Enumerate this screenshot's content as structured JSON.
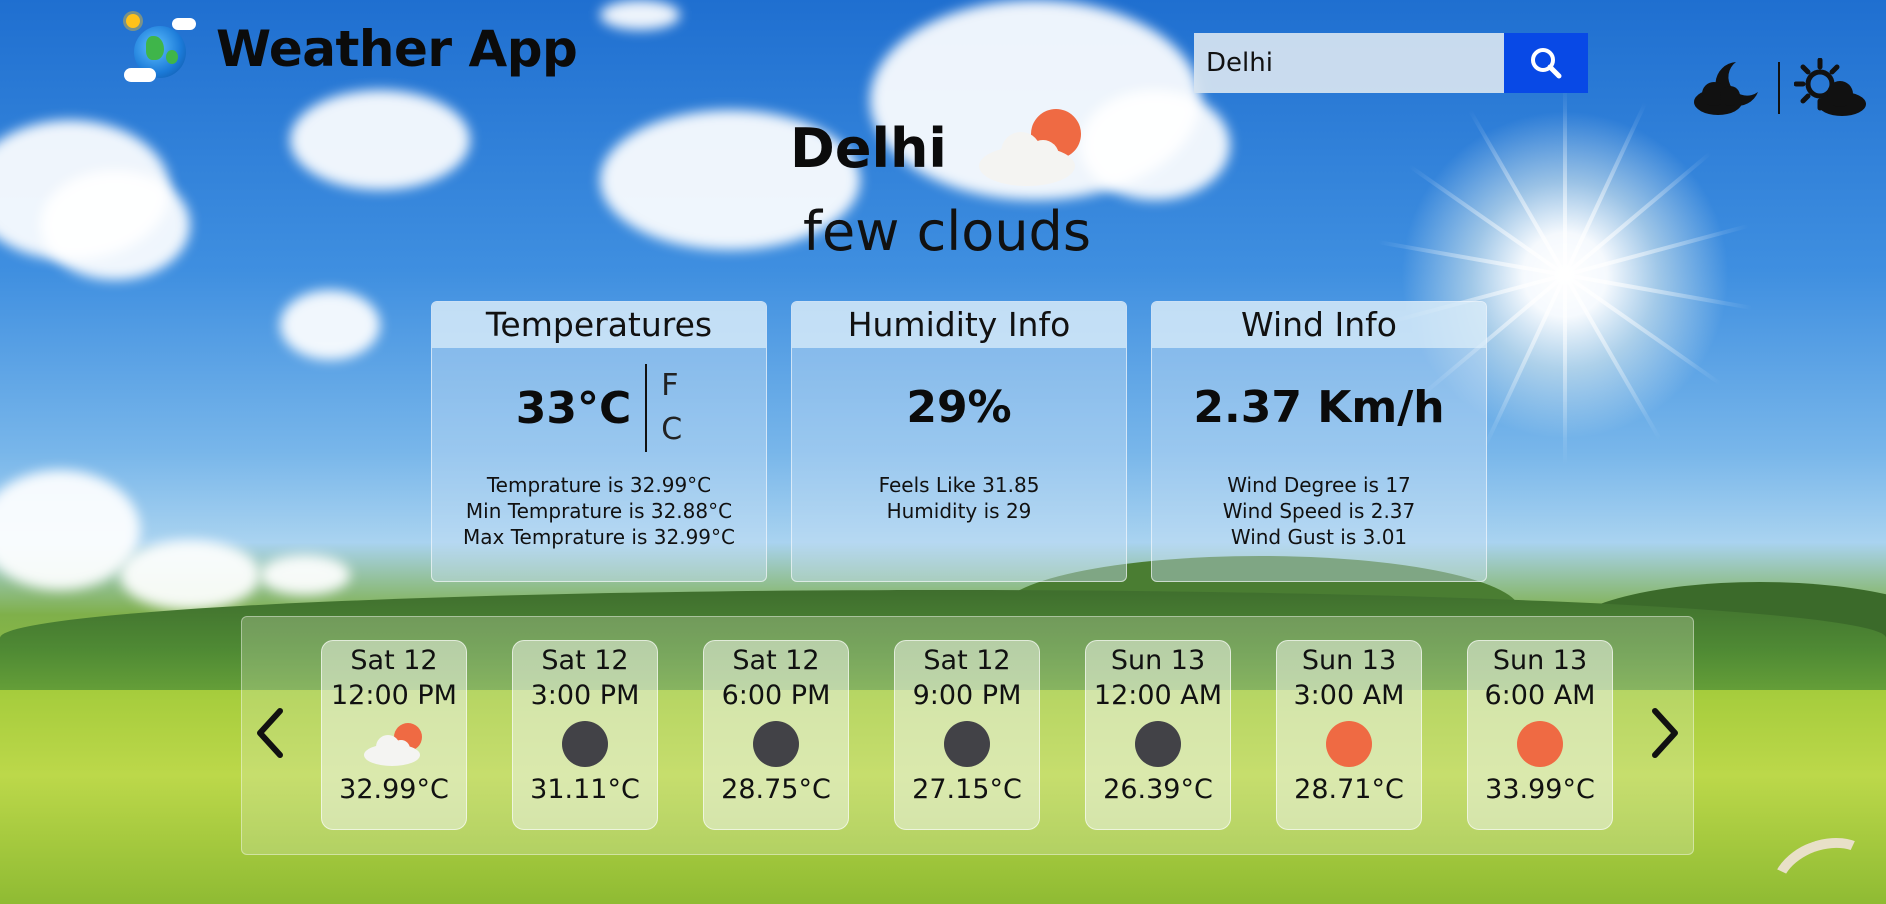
{
  "app": {
    "title": "Weather App"
  },
  "search": {
    "value": "Delhi"
  },
  "current": {
    "city": "Delhi",
    "description": "few clouds",
    "icon": "few-clouds-day-icon"
  },
  "cards": {
    "temperature": {
      "title": "Temperatures",
      "main": "33°C",
      "unit_f": "F",
      "unit_c": "C",
      "lines": [
        "Temprature is 32.99°C",
        "Min Temprature is 32.88°C",
        "Max Temprature is 32.99°C"
      ]
    },
    "humidity": {
      "title": "Humidity Info",
      "main": "29%",
      "lines": [
        "Feels Like 31.85",
        "Humidity is 29"
      ]
    },
    "wind": {
      "title": "Wind Info",
      "main": "2.37 Km/h",
      "lines": [
        "Wind Degree is 17",
        "Wind Speed is 2.37",
        "Wind Gust is 3.01"
      ]
    }
  },
  "forecast": [
    {
      "day": "Sat 12",
      "time": "12:00 PM",
      "icon": "few-clouds-icon",
      "temp": "32.99°C"
    },
    {
      "day": "Sat 12",
      "time": "3:00 PM",
      "icon": "dark-circle-icon",
      "temp": "31.11°C"
    },
    {
      "day": "Sat 12",
      "time": "6:00 PM",
      "icon": "dark-circle-icon",
      "temp": "28.75°C"
    },
    {
      "day": "Sat 12",
      "time": "9:00 PM",
      "icon": "dark-circle-icon",
      "temp": "27.15°C"
    },
    {
      "day": "Sun 13",
      "time": "12:00 AM",
      "icon": "dark-circle-icon",
      "temp": "26.39°C"
    },
    {
      "day": "Sun 13",
      "time": "3:00 AM",
      "icon": "orange-circle-icon",
      "temp": "28.71°C"
    },
    {
      "day": "Sun 13",
      "time": "6:00 AM",
      "icon": "orange-circle-icon",
      "temp": "33.99°C"
    }
  ],
  "colors": {
    "search_button": "#0849e6",
    "dark_dot": "#424247",
    "orange_dot": "#ef6a43"
  }
}
